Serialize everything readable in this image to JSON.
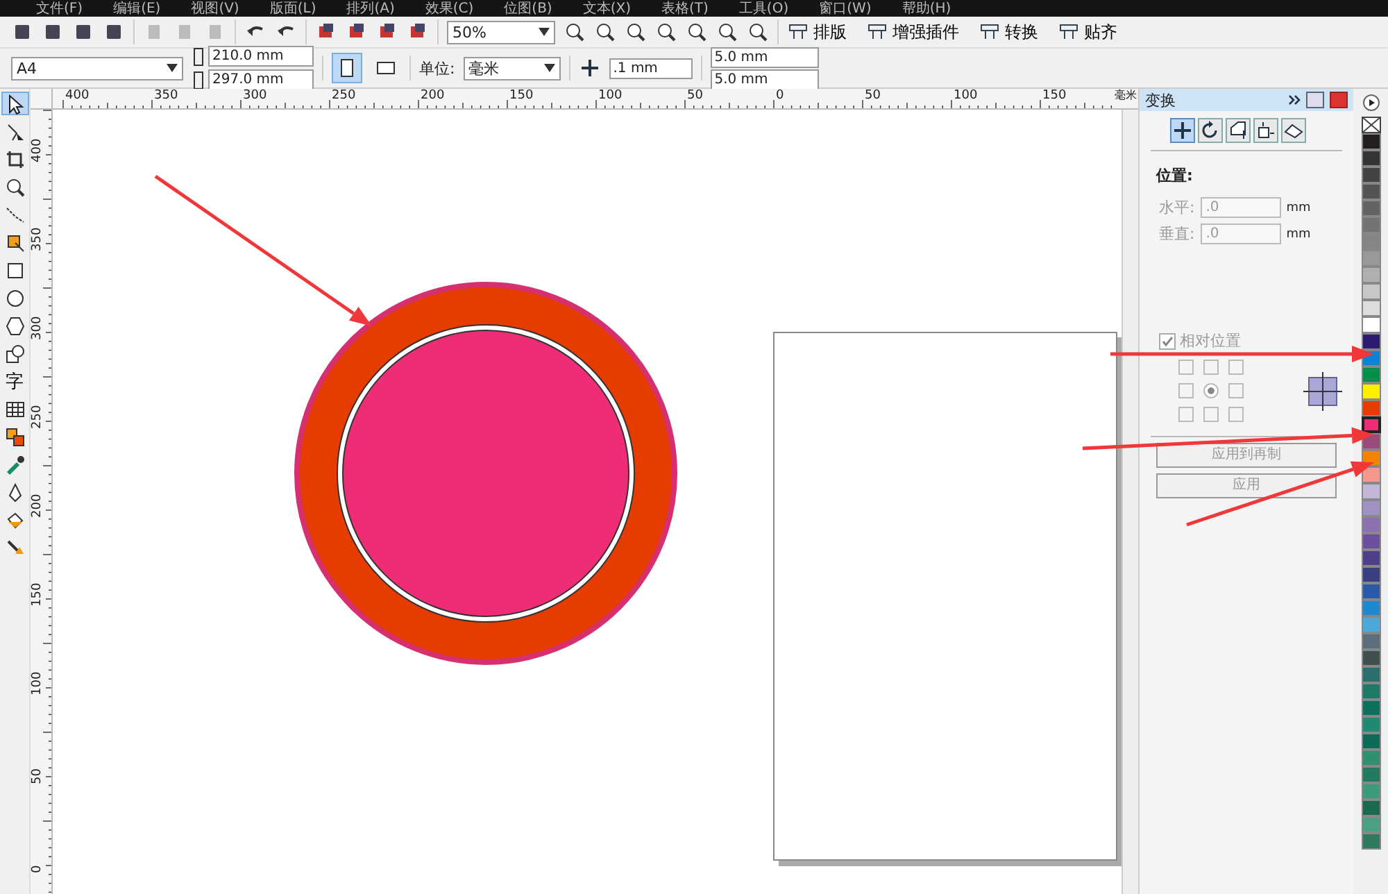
{
  "menu": [
    "文件(F)",
    "编辑(E)",
    "视图(V)",
    "版面(L)",
    "排列(A)",
    "效果(C)",
    "位图(B)",
    "文本(X)",
    "表格(T)",
    "工具(O)",
    "窗口(W)",
    "帮助(H)"
  ],
  "toolbar": {
    "zoom": "50%",
    "buttons": [
      "排版",
      "增强插件",
      "转换",
      "贴齐"
    ]
  },
  "property_bar": {
    "page_size": "A4",
    "width": "210.0 mm",
    "height": "297.0 mm",
    "orientation": [
      {
        "kind": "portrait",
        "selected": true
      },
      {
        "kind": "landscape",
        "selected": false
      }
    ],
    "unit_label": "单位:",
    "unit": "毫米",
    "nudge": ".1 mm",
    "duplicate_x": "5.0 mm",
    "duplicate_y": "5.0 mm"
  },
  "rulers": {
    "horizontal": [
      "400",
      "350",
      "300",
      "250",
      "200",
      "150",
      "100",
      "50",
      "0",
      "50",
      "100",
      "150"
    ],
    "unit": "毫米",
    "vertical": [
      "400",
      "350",
      "300",
      "250",
      "200",
      "150",
      "100",
      "50",
      "0"
    ]
  },
  "tools": [
    {
      "kind": "pick",
      "selected": true
    },
    {
      "kind": "shape",
      "selected": false
    },
    {
      "kind": "crop",
      "selected": false
    },
    {
      "kind": "zoom",
      "selected": false
    },
    {
      "kind": "curve",
      "selected": false
    },
    {
      "kind": "smart",
      "selected": false
    },
    {
      "kind": "rect",
      "selected": false
    },
    {
      "kind": "ellipse",
      "selected": false
    },
    {
      "kind": "polygon",
      "selected": false
    },
    {
      "kind": "basic",
      "selected": false
    },
    {
      "kind": "text",
      "label": "字",
      "selected": false
    },
    {
      "kind": "table",
      "selected": false
    },
    {
      "kind": "blend",
      "selected": false
    },
    {
      "kind": "eyedropper",
      "selected": false
    },
    {
      "kind": "outline",
      "selected": false
    },
    {
      "kind": "fill",
      "selected": false
    },
    {
      "kind": "interactive",
      "selected": false
    }
  ],
  "docker": {
    "title": "变换",
    "tabs": [
      {
        "kind": "position",
        "selected": true
      },
      {
        "kind": "rotate",
        "selected": false
      },
      {
        "kind": "scale",
        "selected": false
      },
      {
        "kind": "size",
        "selected": false
      },
      {
        "kind": "skew",
        "selected": false
      }
    ],
    "section": "位置:",
    "fields": [
      {
        "label": "水平:",
        "value": ".0",
        "unit": "mm"
      },
      {
        "label": "垂直:",
        "value": ".0",
        "unit": "mm"
      }
    ],
    "relative": {
      "label": "相对位置",
      "checked": true
    },
    "anchors": [
      {
        "selected": false
      },
      {
        "selected": false
      },
      {
        "selected": false
      },
      {
        "selected": false
      },
      {
        "selected": true
      },
      {
        "selected": false
      },
      {
        "selected": false
      },
      {
        "selected": false
      },
      {
        "selected": false
      }
    ],
    "buttons": [
      "应用到再制",
      "应用"
    ]
  },
  "palette": [
    {
      "color": "#231f20",
      "selected": false
    },
    {
      "color": "#363435",
      "selected": false
    },
    {
      "color": "#444243",
      "selected": false
    },
    {
      "color": "#545253",
      "selected": false
    },
    {
      "color": "#646263",
      "selected": false
    },
    {
      "color": "#747273",
      "selected": false
    },
    {
      "color": "#868485",
      "selected": false
    },
    {
      "color": "#9a9899",
      "selected": false
    },
    {
      "color": "#b0aeaf",
      "selected": false
    },
    {
      "color": "#c8c6c7",
      "selected": false
    },
    {
      "color": "#dedcdd",
      "selected": false
    },
    {
      "color": "#ffffff",
      "selected": false
    },
    {
      "color": "#2e1a6e",
      "selected": false
    },
    {
      "color": "#0a82d6",
      "selected": false
    },
    {
      "color": "#00904a",
      "selected": false
    },
    {
      "color": "#fff000",
      "selected": false
    },
    {
      "color": "#e63c00",
      "selected": false
    },
    {
      "color": "#ee2d76",
      "selected": true
    },
    {
      "color": "#9c4a7a",
      "selected": false
    },
    {
      "color": "#f18400",
      "selected": false
    },
    {
      "color": "#f4978c",
      "selected": false
    },
    {
      "color": "#c3b6d8",
      "selected": false
    },
    {
      "color": "#a090c4",
      "selected": false
    },
    {
      "color": "#8c70b2",
      "selected": false
    },
    {
      "color": "#6c4f9e",
      "selected": false
    },
    {
      "color": "#50408c",
      "selected": false
    },
    {
      "color": "#3a3f82",
      "selected": false
    },
    {
      "color": "#2a5aa8",
      "selected": false
    },
    {
      "color": "#1d8ad0",
      "selected": false
    },
    {
      "color": "#4aa8da",
      "selected": false
    },
    {
      "color": "#5c6e7c",
      "selected": false
    },
    {
      "color": "#3e5050",
      "selected": false
    },
    {
      "color": "#2a6e6e",
      "selected": false
    },
    {
      "color": "#1d7a68",
      "selected": false
    },
    {
      "color": "#10705e",
      "selected": false
    },
    {
      "color": "#1f8a74",
      "selected": false
    },
    {
      "color": "#0e6b57",
      "selected": false
    },
    {
      "color": "#2f8f6f",
      "selected": false
    },
    {
      "color": "#227a60",
      "selected": false
    },
    {
      "color": "#3b9b7b",
      "selected": false
    },
    {
      "color": "#1a6a50",
      "selected": false
    },
    {
      "color": "#4aa080",
      "selected": false
    },
    {
      "color": "#2f7a5a",
      "selected": false
    }
  ]
}
